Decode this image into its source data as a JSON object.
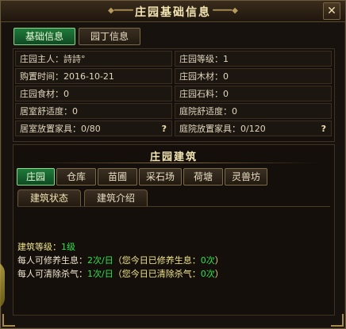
{
  "window": {
    "title": "庄园基础信息",
    "close_label": "✕"
  },
  "top_tabs": [
    {
      "label": "基础信息",
      "active": true
    },
    {
      "label": "园丁信息",
      "active": false
    }
  ],
  "info": {
    "left": [
      {
        "label": "庄园主人",
        "value": "詩詩°"
      },
      {
        "label": "购置时间",
        "value": "2016-10-21"
      },
      {
        "label": "庄园食材",
        "value": "0"
      },
      {
        "label": "居室舒适度",
        "value": "0"
      },
      {
        "label": "居室放置家具",
        "value": "0/80",
        "help": "?"
      }
    ],
    "right": [
      {
        "label": "庄园等级",
        "value": "1"
      },
      {
        "label": "庄园木材",
        "value": "0"
      },
      {
        "label": "庄园石料",
        "value": "0"
      },
      {
        "label": "庭院舒适度",
        "value": "0"
      },
      {
        "label": "庭院放置家具",
        "value": "0/120",
        "help": "?"
      }
    ]
  },
  "building": {
    "title": "庄园建筑",
    "tabs": [
      {
        "label": "庄园",
        "active": true
      },
      {
        "label": "仓库",
        "active": false
      },
      {
        "label": "苗圃",
        "active": false
      },
      {
        "label": "采石场",
        "active": false
      },
      {
        "label": "荷塘",
        "active": false
      },
      {
        "label": "灵兽坊",
        "active": false
      }
    ],
    "subtabs": [
      {
        "label": "建筑状态",
        "active": true
      },
      {
        "label": "建筑介绍",
        "active": false
      }
    ],
    "details": {
      "level_label": "建筑等级：",
      "level_value": "1级",
      "rest_prefix": "每人可修养生息：",
      "rest_value": "2次/日",
      "rest_note_open": "（您今日已修养生息：",
      "rest_today": "0次",
      "rest_note_close": "）",
      "kill_prefix": "每人可清除杀气：",
      "kill_value": "1次/日",
      "kill_note_open": "（您今日已清除杀气：",
      "kill_today": "0次",
      "kill_note_close": "）"
    }
  }
}
